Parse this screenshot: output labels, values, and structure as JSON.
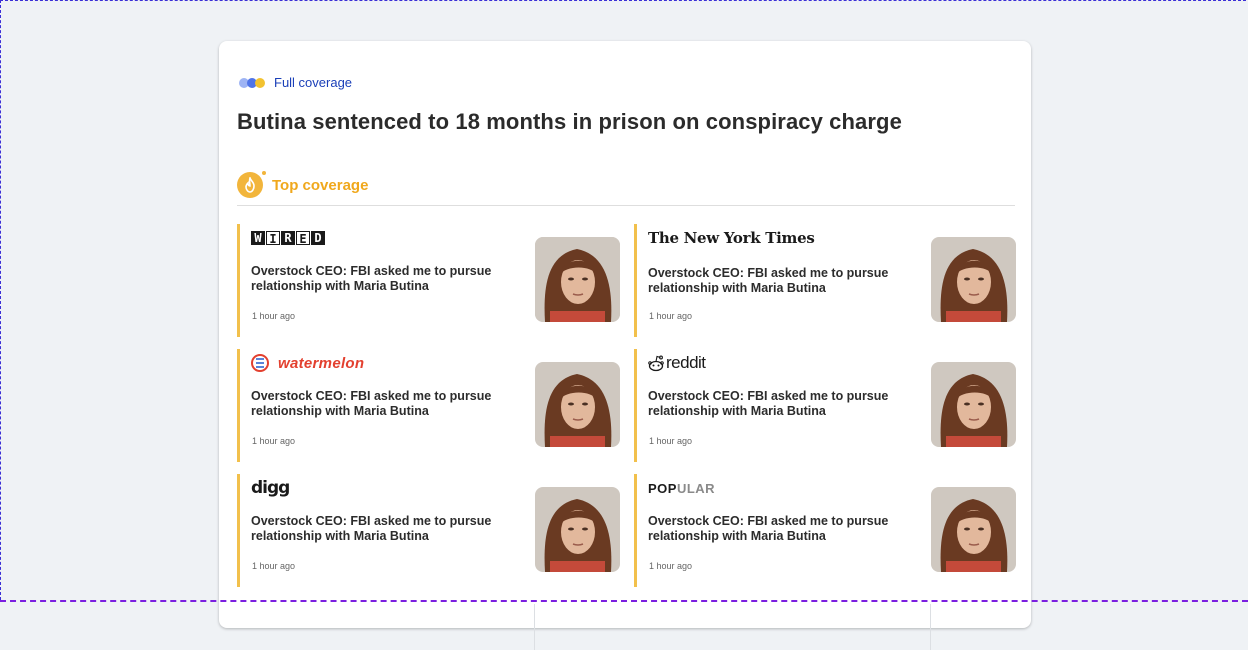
{
  "header": {
    "full_coverage_label": "Full coverage",
    "headline": "Butina sentenced to 18 months in prison on conspiracy charge"
  },
  "section": {
    "title": "Top coverage"
  },
  "sources": {
    "wired": [
      "W",
      "I",
      "R",
      "E",
      "D"
    ],
    "nyt": "The New York Times",
    "watermelon": "watermelon",
    "reddit": "reddit",
    "digg": "digg",
    "popular_dark": "POP",
    "popular_light": "ULAR"
  },
  "stories": [
    {
      "source": "WIRED",
      "title": "Overstock CEO: FBI asked me to pursue relationship with Maria Butina",
      "time": "1 hour ago"
    },
    {
      "source": "The New York Times",
      "title": "Overstock CEO: FBI asked me to pursue relationship with Maria Butina",
      "time": "1 hour ago"
    },
    {
      "source": "watermelon",
      "title": "Overstock CEO: FBI asked me to pursue relationship with Maria Butina",
      "time": "1 hour ago"
    },
    {
      "source": "reddit",
      "title": "Overstock CEO: FBI asked me to pursue relationship with Maria Butina",
      "time": "1 hour ago"
    },
    {
      "source": "digg",
      "title": "Overstock CEO: FBI asked me to pursue relationship with Maria Butina",
      "time": "1 hour ago"
    },
    {
      "source": "POPULAR",
      "title": "Overstock CEO: FBI asked me to pursue relationship with Maria Butina",
      "time": "1 hour ago"
    }
  ],
  "colors": {
    "accent_blue": "#1a3fb8",
    "accent_orange": "#f0a81c",
    "story_border": "#f2c04c",
    "watermelon_red": "#e3402f"
  },
  "icons": {
    "full_coverage": "full-coverage-dots-icon",
    "top_coverage": "fire-icon",
    "thumbnail": "portrait-photo"
  }
}
